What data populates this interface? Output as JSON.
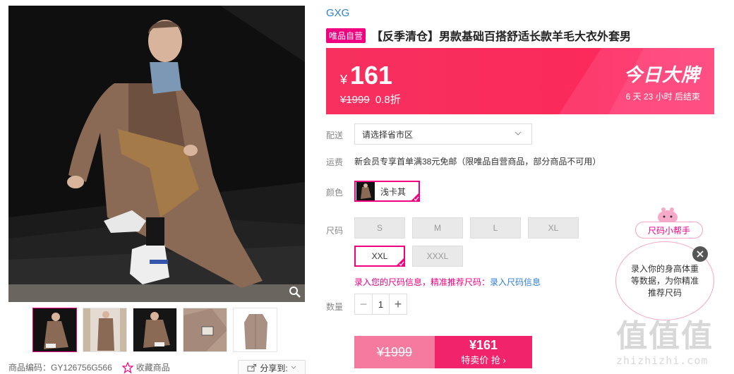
{
  "product": {
    "brand": "GXG",
    "badge": "唯品自营",
    "title": "【反季清仓】男款基础百搭舒适长款羊毛大衣外套男"
  },
  "price": {
    "currency": "¥",
    "now": "161",
    "original": "¥1999",
    "discount": "0.8折",
    "promo_name": "今日大牌",
    "countdown": "6  天  23  小时  后结束",
    "bg_color": "#f7305f"
  },
  "delivery": {
    "label": "配送",
    "placeholder": "请选择省市区"
  },
  "freight": {
    "label": "运费",
    "text": "新会员专享首单满38元免邮（限唯品自营商品，部分商品不可用）"
  },
  "color": {
    "label": "颜色",
    "selected": "浅卡其"
  },
  "size": {
    "label": "尺码",
    "options": [
      "S",
      "M",
      "L",
      "XL",
      "XXL",
      "XXXL"
    ],
    "selected": "XXL",
    "hint": "录入您的尺码信息，精准推荐尺码：",
    "hint_link": "录入尺码信息"
  },
  "quantity": {
    "label": "数量",
    "value": "1",
    "minus": "−",
    "plus": "+"
  },
  "buy": {
    "original": "¥1999",
    "price": "¥161",
    "action": "特卖价 抢 ›"
  },
  "helper": {
    "tag": "尺码小帮手",
    "bubble": "录入你的身高体重等数据，为你精准推荐尺码"
  },
  "footer": {
    "sku": "商品编码：GY126756G566",
    "favorite": "收藏商品",
    "share": "分享到:"
  },
  "watermark": {
    "big": "值值值",
    "small": "zhizhizhi.com"
  },
  "icons": {
    "zoom": "magnifier-icon",
    "favorite": "star-icon",
    "share": "share-icon",
    "close": "close-icon",
    "dropdown": "chevron-down-icon"
  },
  "colors": {
    "accent": "#f10180",
    "link": "#2f7fd1"
  }
}
